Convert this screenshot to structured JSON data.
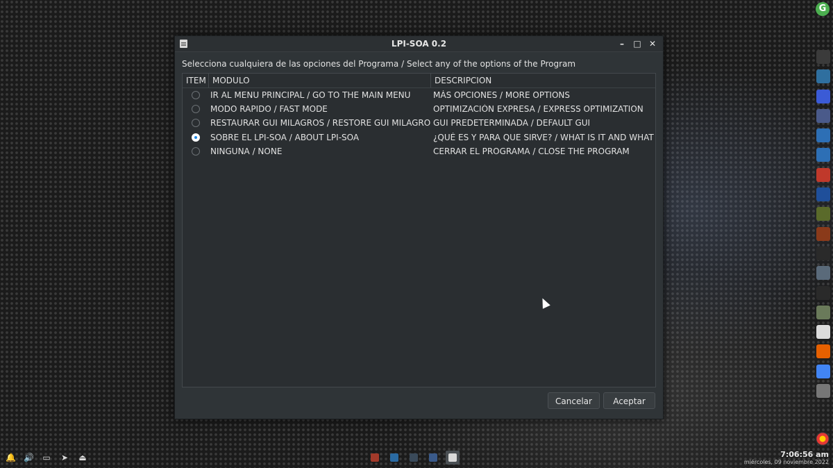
{
  "desktop": {
    "top_right_icon_letter": "G"
  },
  "window": {
    "title": "LPI-SOA 0.2",
    "prompt": "Selecciona cualquiera de las opciones del Programa / Select any of the options of the Program",
    "buttons": {
      "minimize": "–",
      "maximize": "□",
      "close": "✕"
    }
  },
  "table": {
    "headers": [
      "ITEM",
      "MODULO",
      "DESCRIPCION"
    ],
    "rows": [
      {
        "selected": false,
        "modulo": "IR AL MENU PRINCIPAL / GO TO THE MAIN MENU",
        "descripcion": "MÁS OPCIONES / MORE OPTIONS"
      },
      {
        "selected": false,
        "modulo": "MODO RAPIDO / FAST MODE",
        "descripcion": "OPTIMIZACIÓN EXPRESA / EXPRESS OPTIMIZATION"
      },
      {
        "selected": false,
        "modulo": "RESTAURAR GUI MILAGROS / RESTORE GUI MILAGROS",
        "descripcion": "GUI PREDETERMINADA / DEFAULT GUI"
      },
      {
        "selected": true,
        "modulo": "SOBRE EL LPI-SOA / ABOUT LPI-SOA",
        "descripcion": "¿QUÉ ES Y PARA QUE SIRVE? / WHAT IS IT AND WHAT IS"
      },
      {
        "selected": false,
        "modulo": "NINGUNA / NONE",
        "descripcion": "CERRAR EL PROGRAMA / CLOSE THE PROGRAM"
      }
    ]
  },
  "actions": {
    "cancel": "Cancelar",
    "accept": "Aceptar"
  },
  "dock": [
    {
      "icon": "x-close-icon",
      "color": "#3b3b3b"
    },
    {
      "icon": "tools-icon",
      "color": "#2f6f9f"
    },
    {
      "icon": "app-blue-icon",
      "color": "#3b5bd6"
    },
    {
      "icon": "disk-icon",
      "color": "#4a5a8a"
    },
    {
      "icon": "cursor-app-icon",
      "color": "#2d6fb5"
    },
    {
      "icon": "cursor-app-2-icon",
      "color": "#2d6fb5"
    },
    {
      "icon": "tiles-icon",
      "color": "#c0392b"
    },
    {
      "icon": "list-app-icon",
      "color": "#1f4f9a"
    },
    {
      "icon": "equalizer-icon",
      "color": "#5a6a2a"
    },
    {
      "icon": "lpi-eye-icon",
      "color": "#8a3a1a"
    },
    {
      "icon": "dark-app-icon",
      "color": "#2a2a2a"
    },
    {
      "icon": "cloud-icon",
      "color": "#5a6a7a"
    },
    {
      "icon": "terminal-icon",
      "color": "#2a2a2a"
    },
    {
      "icon": "files-icon",
      "color": "#6a7a5a"
    },
    {
      "icon": "document-icon",
      "color": "#dcdcdc"
    },
    {
      "icon": "firefox-icon",
      "color": "#e66000"
    },
    {
      "icon": "chrome-icon",
      "color": "#4285f4"
    },
    {
      "icon": "settings-icon",
      "color": "#777777"
    }
  ],
  "tray_icons": [
    "bell-icon",
    "volume-icon",
    "screen-icon",
    "telegram-icon",
    "eject-icon"
  ],
  "taskbar": [
    {
      "icon": "red-app-icon",
      "color": "#a23a2a",
      "active": false
    },
    {
      "icon": "blue-app-icon",
      "color": "#2a6aa2",
      "active": false
    },
    {
      "icon": "monitor-app-icon",
      "color": "#3a4a5a",
      "active": false
    },
    {
      "icon": "window-app-icon",
      "color": "#3a5a8a",
      "active": false
    },
    {
      "icon": "lpi-soa-app-icon",
      "color": "#d9d9d9",
      "active": true
    }
  ],
  "clock": {
    "time": "7:06:56 am",
    "date": "miércoles, 09 noviembre 2022"
  }
}
